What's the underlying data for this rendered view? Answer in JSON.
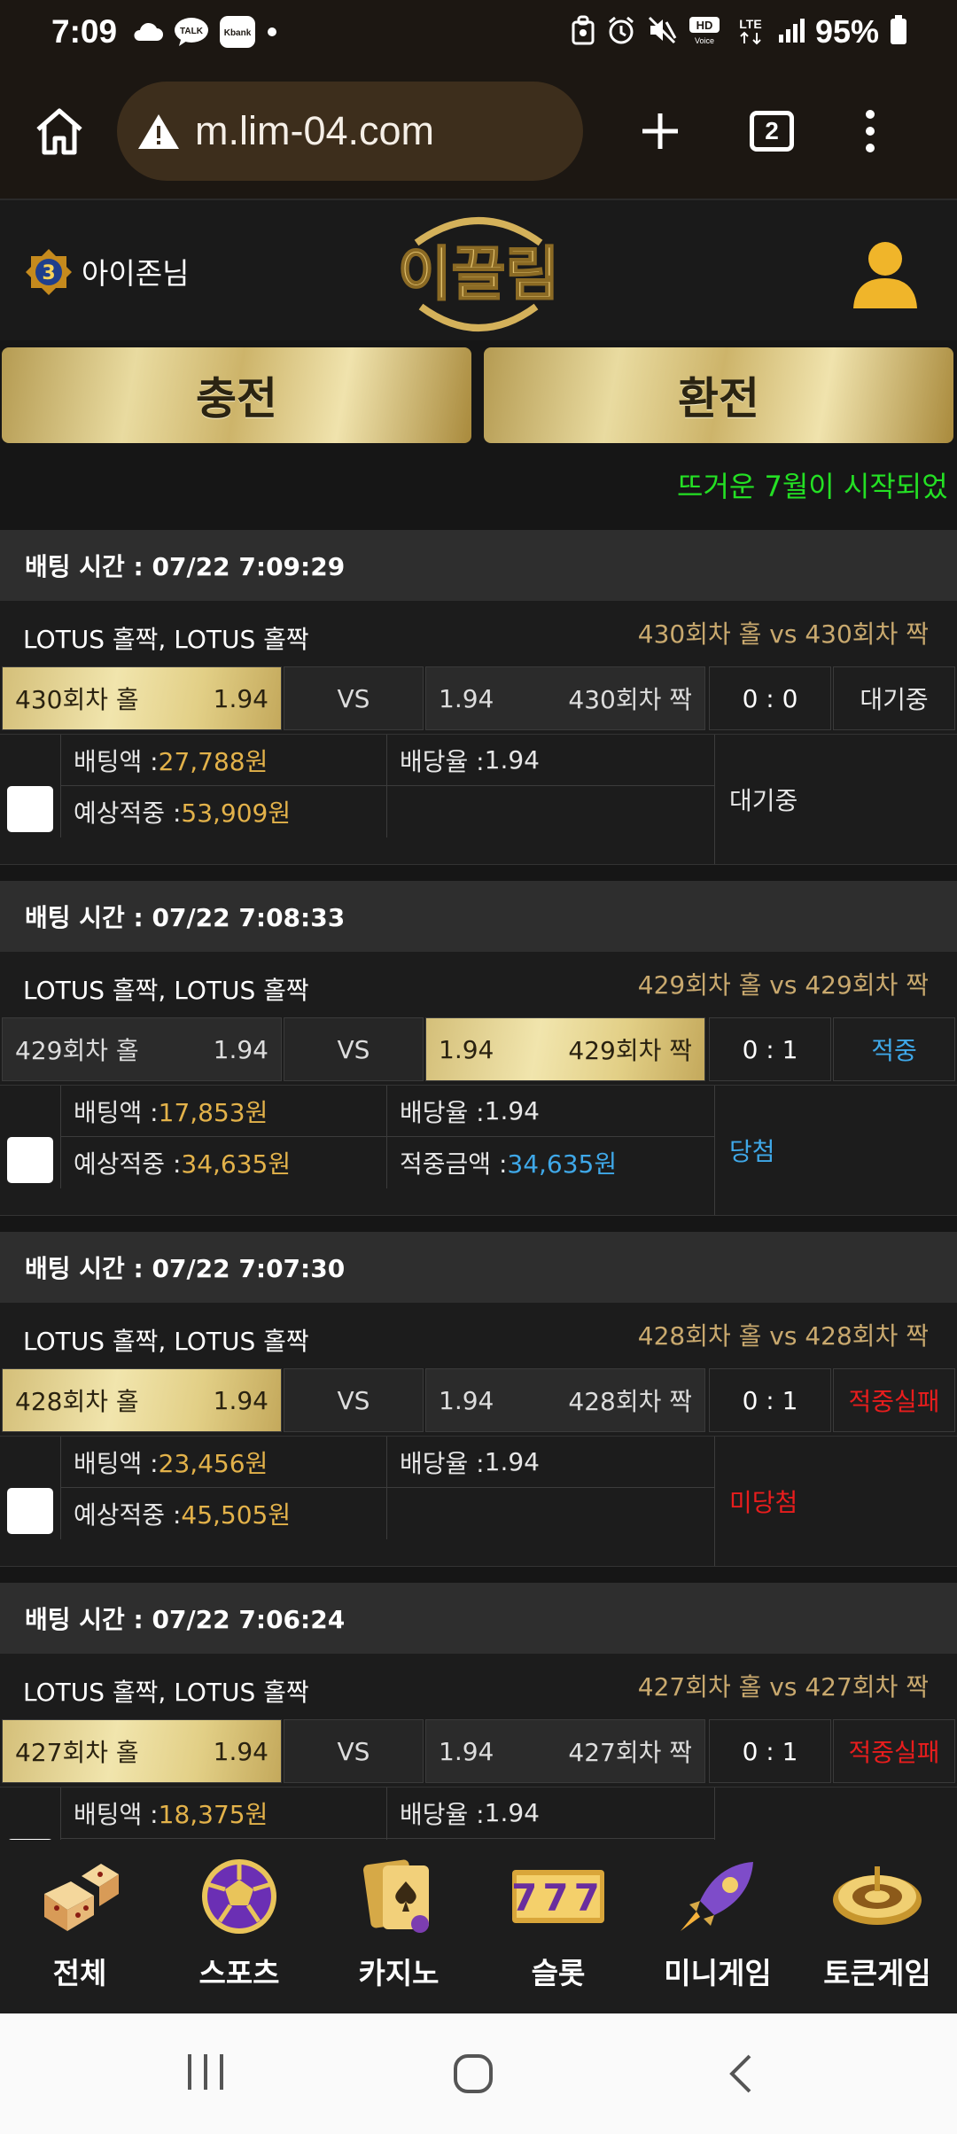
{
  "status_bar": {
    "time": "7:09",
    "battery": "95%",
    "kbank_label": "Kbank",
    "talk_label": "TALK",
    "lte_label": "LTE",
    "hd_label": "HD"
  },
  "browser": {
    "url": "m.lim-04.com",
    "tab_count": "2"
  },
  "header": {
    "user_name": "아이존님",
    "rank_level": "3",
    "logo_text": "이끌림"
  },
  "actions": {
    "deposit": "충전",
    "withdraw": "환전"
  },
  "ticker": "뜨거운 7월이 시작되었",
  "bets": [
    {
      "time_label": "배팅 시간 : 07/22 7:09:29",
      "game": "LOTUS 홀짝, LOTUS 홀짝",
      "matchup": "430회차 홀  vs  430회차 짝",
      "home": "430회차 홀",
      "home_odds": "1.94",
      "vs": "VS",
      "away_odds": "1.94",
      "away": "430회차 짝",
      "score": "0 : 0",
      "status": "대기중",
      "bet_label": "배팅액 : ",
      "bet_amount": "27,788원",
      "rate_label": "배당율 : ",
      "rate": "1.94",
      "expected_label": "예상적중 : ",
      "expected": "53,909원",
      "win_label": "",
      "win_amount": "",
      "result": "대기중",
      "selected": "home",
      "status_color": "#e6e6e6"
    },
    {
      "time_label": "배팅 시간 : 07/22 7:08:33",
      "game": "LOTUS 홀짝, LOTUS 홀짝",
      "matchup": "429회차 홀  vs  429회차 짝",
      "home": "429회차 홀",
      "home_odds": "1.94",
      "vs": "VS",
      "away_odds": "1.94",
      "away": "429회차 짝",
      "score": "0 : 1",
      "status": "적중",
      "bet_label": "배팅액 : ",
      "bet_amount": "17,853원",
      "rate_label": "배당율 : ",
      "rate": "1.94",
      "expected_label": "예상적중 : ",
      "expected": "34,635원",
      "win_label": "적중금액 : ",
      "win_amount": "34,635원",
      "result": "당첨",
      "selected": "away",
      "status_color": "#3fa8e8"
    },
    {
      "time_label": "배팅 시간 : 07/22 7:07:30",
      "game": "LOTUS 홀짝, LOTUS 홀짝",
      "matchup": "428회차 홀  vs  428회차 짝",
      "home": "428회차 홀",
      "home_odds": "1.94",
      "vs": "VS",
      "away_odds": "1.94",
      "away": "428회차 짝",
      "score": "0 : 1",
      "status": "적중실패",
      "bet_label": "배팅액 : ",
      "bet_amount": "23,456원",
      "rate_label": "배당율 : ",
      "rate": "1.94",
      "expected_label": "예상적중 : ",
      "expected": "45,505원",
      "win_label": "",
      "win_amount": "",
      "result": "미당첨",
      "selected": "home",
      "status_color": "#e81d1d"
    },
    {
      "time_label": "배팅 시간 : 07/22 7:06:24",
      "game": "LOTUS 홀짝, LOTUS 홀짝",
      "matchup": "427회차 홀  vs  427회차 짝",
      "home": "427회차 홀",
      "home_odds": "1.94",
      "vs": "VS",
      "away_odds": "1.94",
      "away": "427회차 짝",
      "score": "0 : 1",
      "status": "적중실패",
      "bet_label": "배팅액 : ",
      "bet_amount": "18,375원",
      "rate_label": "배당율 : ",
      "rate": "1.94",
      "expected_label": "",
      "expected": "",
      "win_label": "",
      "win_amount": "",
      "result": "",
      "selected": "home",
      "status_color": "#e81d1d"
    }
  ],
  "nav": [
    {
      "label": "전체",
      "icon": "dice-icon"
    },
    {
      "label": "스포츠",
      "icon": "soccer-ball-icon"
    },
    {
      "label": "카지노",
      "icon": "cards-icon"
    },
    {
      "label": "슬롯",
      "icon": "slot-777-icon"
    },
    {
      "label": "미니게임",
      "icon": "rocket-icon"
    },
    {
      "label": "토큰게임",
      "icon": "roulette-icon"
    }
  ],
  "slot_text": "777"
}
